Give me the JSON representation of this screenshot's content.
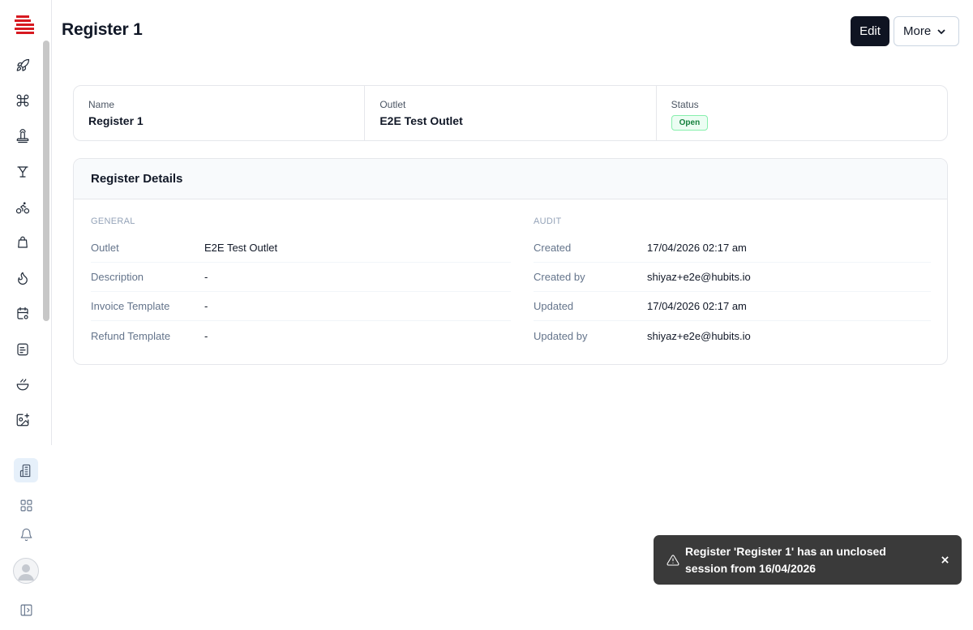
{
  "header": {
    "title": "Register 1",
    "edit_label": "Edit",
    "more_label": "More"
  },
  "sidebar": {
    "logo": "brand-logo",
    "items": [
      {
        "icon": "rocket-icon"
      },
      {
        "icon": "command-icon"
      },
      {
        "icon": "stamp-icon"
      },
      {
        "icon": "cocktail-icon"
      },
      {
        "icon": "bicycle-icon"
      },
      {
        "icon": "shopping-bag-icon"
      },
      {
        "icon": "flame-icon"
      },
      {
        "icon": "calendar-settings-icon"
      },
      {
        "icon": "receipt-icon"
      },
      {
        "icon": "bowl-icon"
      },
      {
        "icon": "image-add-icon"
      }
    ],
    "bottom": [
      {
        "icon": "building-icon",
        "active": true
      },
      {
        "icon": "grid-icon"
      },
      {
        "icon": "bell-icon"
      },
      {
        "icon": "avatar"
      },
      {
        "icon": "sidebar-toggle-icon"
      }
    ]
  },
  "summary": {
    "name": {
      "label": "Name",
      "value": "Register 1"
    },
    "outlet": {
      "label": "Outlet",
      "value": "E2E Test Outlet"
    },
    "status": {
      "label": "Status",
      "value": "Open"
    }
  },
  "details": {
    "title": "Register Details",
    "general": {
      "title": "GENERAL",
      "rows": [
        {
          "label": "Outlet",
          "value": "E2E Test Outlet"
        },
        {
          "label": "Description",
          "value": "-"
        },
        {
          "label": "Invoice Template",
          "value": "-"
        },
        {
          "label": "Refund Template",
          "value": "-"
        }
      ]
    },
    "audit": {
      "title": "AUDIT",
      "rows": [
        {
          "label": "Created",
          "value": "17/04/2026 02:17 am"
        },
        {
          "label": "Created by",
          "value": "shiyaz+e2e@hubits.io"
        },
        {
          "label": "Updated",
          "value": "17/04/2026 02:17 am"
        },
        {
          "label": "Updated by",
          "value": "shiyaz+e2e@hubits.io"
        }
      ]
    }
  },
  "toast": {
    "message": "Register 'Register 1' has an unclosed session from 16/04/2026",
    "icon": "warning-icon",
    "close_icon": "close-icon"
  },
  "colors": {
    "primary_button": "#0f1422",
    "status_open": "#15803d",
    "toast_bg": "#3a3a3a",
    "brand_red": "#d71920"
  }
}
